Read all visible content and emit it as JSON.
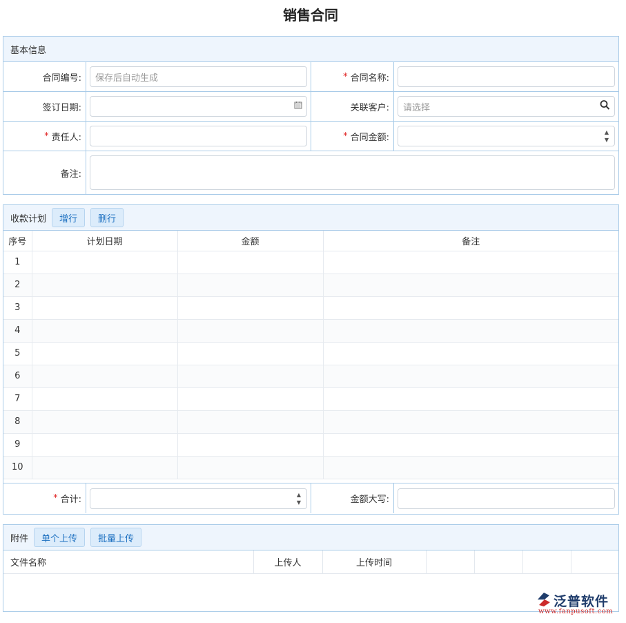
{
  "page": {
    "title": "销售合同"
  },
  "basic": {
    "title": "基本信息",
    "contract_no": {
      "label": "合同编号:",
      "placeholder": "保存后自动生成"
    },
    "contract_name": {
      "label": "合同名称:",
      "value": ""
    },
    "sign_date": {
      "label": "签订日期:",
      "value": ""
    },
    "customer": {
      "label": "关联客户:",
      "placeholder": "请选择"
    },
    "owner": {
      "label": "责任人:",
      "value": ""
    },
    "amount": {
      "label": "合同金额:",
      "value": ""
    },
    "remark": {
      "label": "备注:",
      "value": ""
    }
  },
  "payment": {
    "title": "收款计划",
    "add_label": "增行",
    "delete_label": "删行",
    "columns": [
      "序号",
      "计划日期",
      "金额",
      "备注"
    ],
    "rows": [
      "1",
      "2",
      "3",
      "4",
      "5",
      "6",
      "7",
      "8",
      "9",
      "10"
    ],
    "total": {
      "label": "合计:",
      "value": ""
    },
    "amount_upper": {
      "label": "金额大写:",
      "value": ""
    }
  },
  "attachments": {
    "title": "附件",
    "single_upload_label": "单个上传",
    "batch_upload_label": "批量上传",
    "columns": [
      "文件名称",
      "上传人",
      "上传时间",
      "",
      "",
      "",
      ""
    ]
  },
  "brand": {
    "name": "泛普软件",
    "url": "www.fanpusoft.com"
  },
  "icons": {
    "date": "calendar-icon",
    "customer": "search-icon",
    "stepper": "stepper-icon",
    "logo": "fanpu-logo-icon"
  }
}
